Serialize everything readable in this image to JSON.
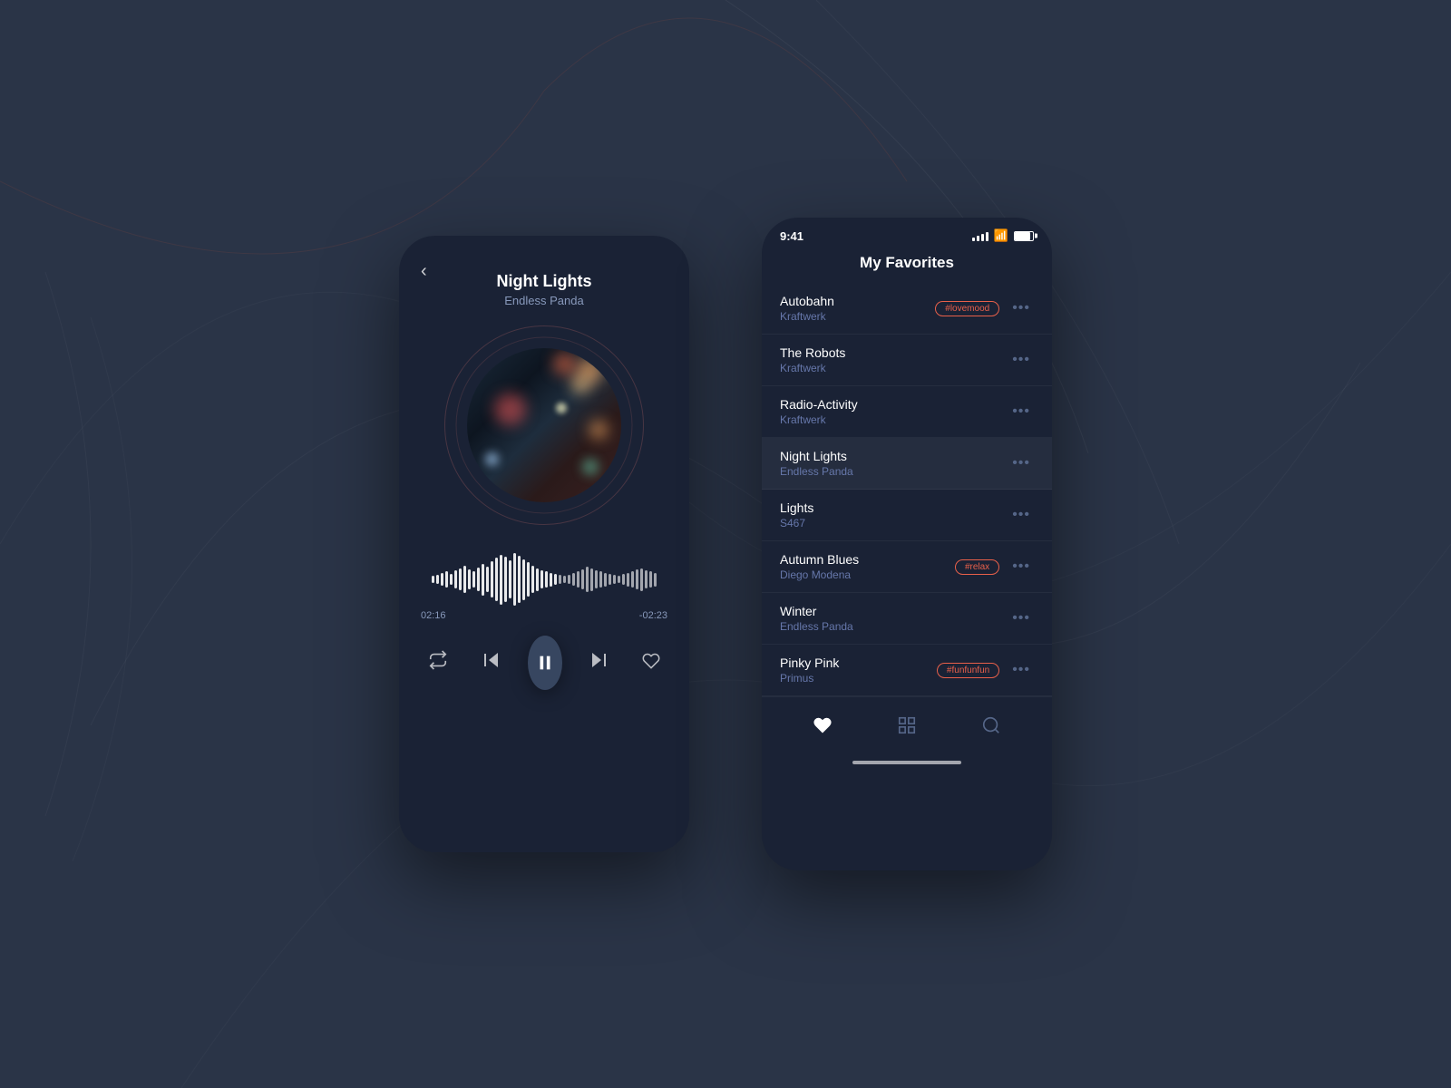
{
  "background": {
    "color": "#2a3447"
  },
  "player": {
    "back_label": "‹",
    "title": "Night Lights",
    "artist": "Endless Panda",
    "time_current": "02:16",
    "time_remaining": "-02:23",
    "controls": {
      "repeat_label": "repeat",
      "prev_label": "prev",
      "pause_label": "pause",
      "next_label": "next",
      "heart_label": "favorite"
    }
  },
  "favorites": {
    "status_time": "9:41",
    "title": "My Favorites",
    "songs": [
      {
        "id": 1,
        "name": "Autobahn",
        "artist": "Kraftwerk",
        "tag": "#lovemood",
        "active": false
      },
      {
        "id": 2,
        "name": "The Robots",
        "artist": "Kraftwerk",
        "tag": null,
        "active": false
      },
      {
        "id": 3,
        "name": "Radio-Activity",
        "artist": "Kraftwerk",
        "tag": null,
        "active": false
      },
      {
        "id": 4,
        "name": "Night Lights",
        "artist": "Endless Panda",
        "tag": null,
        "active": true
      },
      {
        "id": 5,
        "name": "Lights",
        "artist": "S467",
        "tag": null,
        "active": false
      },
      {
        "id": 6,
        "name": "Autumn Blues",
        "artist": "Diego Modena",
        "tag": "#relax",
        "active": false
      },
      {
        "id": 7,
        "name": "Winter",
        "artist": "Endless Panda",
        "tag": null,
        "active": false
      },
      {
        "id": 8,
        "name": "Pinky Pink",
        "artist": "Primus",
        "tag": "#funfunfun",
        "active": false
      }
    ],
    "nav": {
      "heart": "favorites",
      "grid": "browse",
      "search": "search"
    }
  }
}
